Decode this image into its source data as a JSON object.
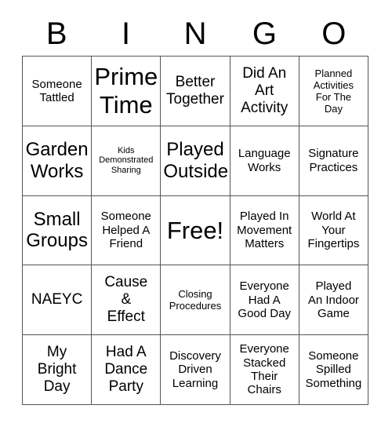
{
  "card": {
    "header_letters": [
      "B",
      "I",
      "N",
      "G",
      "O"
    ],
    "free_space_label": "Free!",
    "rows": [
      [
        {
          "text": "Someone\nTattled",
          "size": "m"
        },
        {
          "text": "Prime\nTime",
          "size": "xxl"
        },
        {
          "text": "Better\nTogether",
          "size": "l"
        },
        {
          "text": "Did An\nArt\nActivity",
          "size": "l"
        },
        {
          "text": "Planned\nActivities\nFor The\nDay",
          "size": "s"
        }
      ],
      [
        {
          "text": "Garden\nWorks",
          "size": "xl"
        },
        {
          "text": "Kids\nDemonstrated\nSharing",
          "size": "xs"
        },
        {
          "text": "Played\nOutside",
          "size": "xl"
        },
        {
          "text": "Language\nWorks",
          "size": "m"
        },
        {
          "text": "Signature\nPractices",
          "size": "m"
        }
      ],
      [
        {
          "text": "Small\nGroups",
          "size": "xl"
        },
        {
          "text": "Someone\nHelped A\nFriend",
          "size": "m"
        },
        {
          "text": "Free!",
          "size": "xxl"
        },
        {
          "text": "Played In\nMovement\nMatters",
          "size": "m"
        },
        {
          "text": "World At\nYour\nFingertips",
          "size": "m"
        }
      ],
      [
        {
          "text": "NAEYC",
          "size": "l"
        },
        {
          "text": "Cause\n&\nEffect",
          "size": "l"
        },
        {
          "text": "Closing\nProcedures",
          "size": "s"
        },
        {
          "text": "Everyone\nHad A\nGood Day",
          "size": "m"
        },
        {
          "text": "Played\nAn Indoor\nGame",
          "size": "m"
        }
      ],
      [
        {
          "text": "My\nBright\nDay",
          "size": "l"
        },
        {
          "text": "Had A\nDance\nParty",
          "size": "l"
        },
        {
          "text": "Discovery\nDriven\nLearning",
          "size": "m"
        },
        {
          "text": "Everyone\nStacked\nTheir\nChairs",
          "size": "m"
        },
        {
          "text": "Someone\nSpilled\nSomething",
          "size": "m"
        }
      ]
    ]
  },
  "colors": {
    "grid_line": "#555555",
    "text": "#000000",
    "background": "#ffffff"
  }
}
